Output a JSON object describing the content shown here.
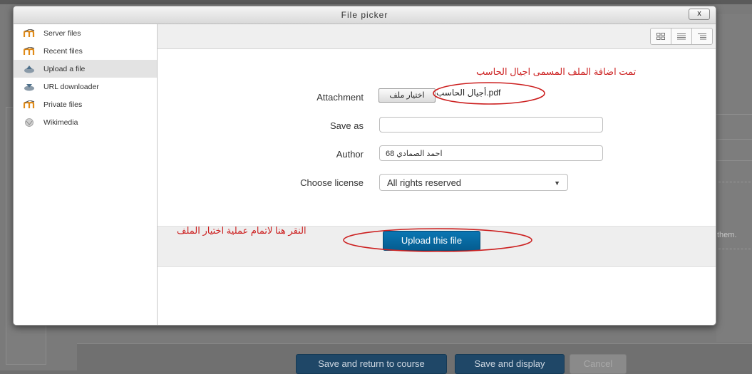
{
  "dialog": {
    "title": "File picker",
    "close_label": "x"
  },
  "sidebar": {
    "items": [
      {
        "label": "Server files",
        "icon": "moodle-icon"
      },
      {
        "label": "Recent files",
        "icon": "moodle-icon"
      },
      {
        "label": "Upload a file",
        "icon": "upload-icon",
        "active": true
      },
      {
        "label": "URL downloader",
        "icon": "download-icon"
      },
      {
        "label": "Private files",
        "icon": "moodle-icon"
      },
      {
        "label": "Wikimedia",
        "icon": "wikimedia-icon"
      }
    ]
  },
  "toolbar": {
    "views": [
      "icons-view-icon",
      "list-view-icon",
      "tree-view-icon"
    ]
  },
  "form": {
    "annotation_top": "تمت اضافة الملف المسمى اجيال الحاسب",
    "attachment_label": "Attachment",
    "choose_file_label": "اختيار ملف",
    "file_name": "أجيال الحاسب.pdf",
    "save_as_label": "Save as",
    "save_as_value": "",
    "author_label": "Author",
    "author_value": "احمد الصمادي 68",
    "license_label": "Choose license",
    "license_value": "All rights reserved"
  },
  "action": {
    "annotation_bottom": "النقر هنا لاتمام عملية اختيار الملف",
    "upload_label": "Upload this file"
  },
  "background": {
    "them_text": "them.",
    "save_return_label": "Save and return to course",
    "save_display_label": "Save and display",
    "cancel_label": "Cancel"
  },
  "colors": {
    "annotation": "#cc1f1f",
    "primary_button": "#0a6aa1"
  }
}
